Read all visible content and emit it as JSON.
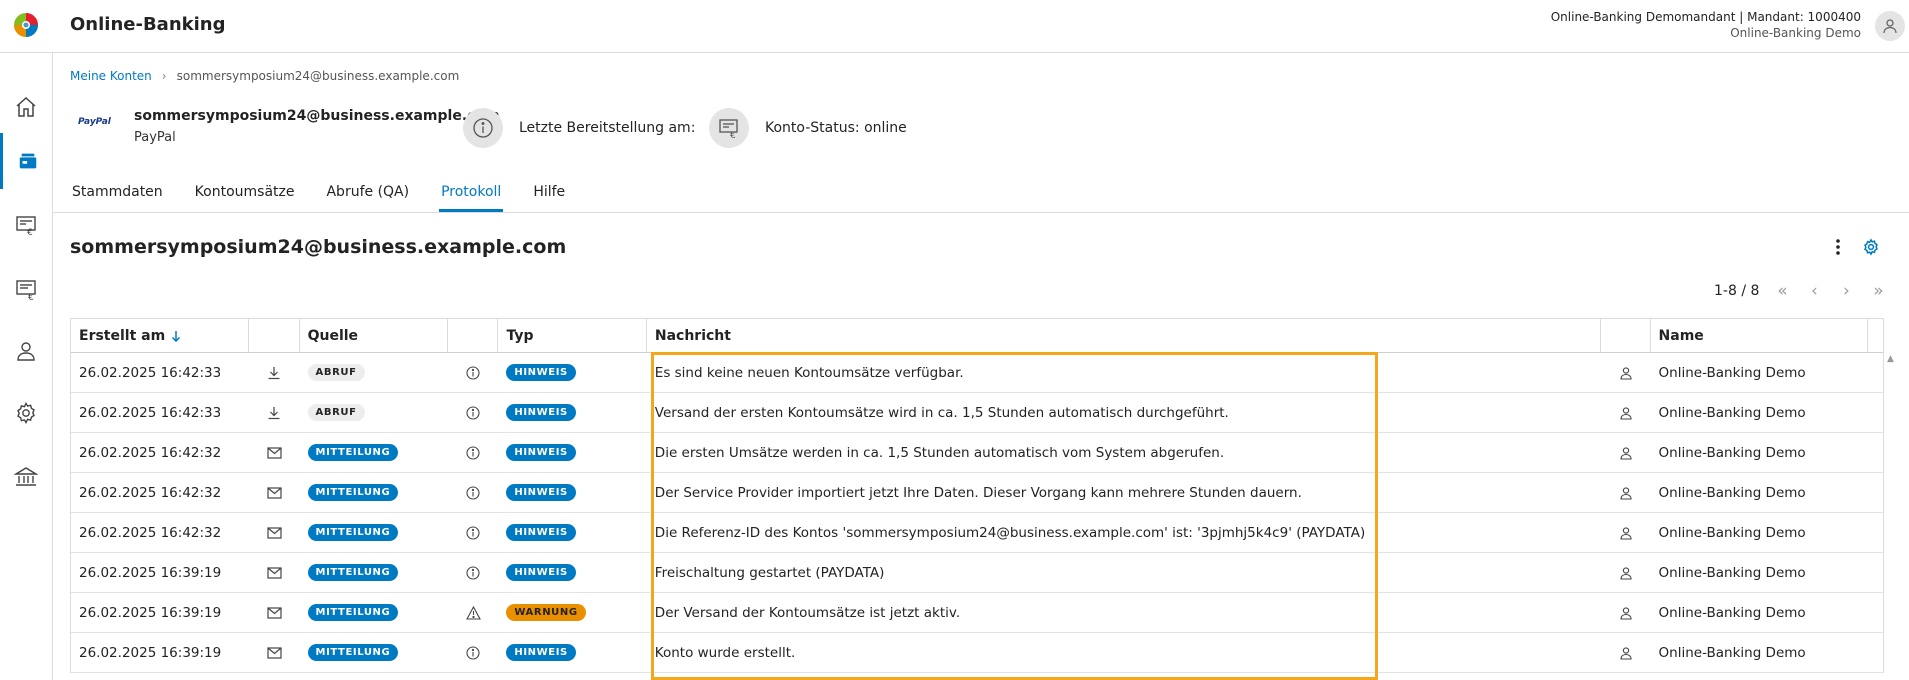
{
  "header": {
    "app_title": "Online-Banking",
    "tenant_line1": "Online-Banking Demomandant | Mandant: 1000400",
    "tenant_line2": "Online-Banking Demo"
  },
  "sidebar": {
    "items": [
      {
        "icon": "home-icon"
      },
      {
        "icon": "accounts-icon",
        "active": true
      },
      {
        "icon": "payments-icon"
      },
      {
        "icon": "statements-icon"
      },
      {
        "icon": "user-icon"
      },
      {
        "icon": "gear-icon"
      },
      {
        "icon": "bank-icon"
      }
    ]
  },
  "breadcrumb": {
    "root": "Meine Konten",
    "current": "sommersymposium24@business.example.com"
  },
  "account": {
    "logo_text": "PayPal",
    "name": "sommersymposium24@business.example.com",
    "provider": "PayPal",
    "last_provision_label": "Letzte Bereitstellung am:",
    "status_label": "Konto-Status: online"
  },
  "tabs": [
    {
      "label": "Stammdaten"
    },
    {
      "label": "Kontoumsätze"
    },
    {
      "label": "Abrufe (QA)"
    },
    {
      "label": "Protokoll",
      "active": true
    },
    {
      "label": "Hilfe"
    }
  ],
  "section": {
    "title": "sommersymposium24@business.example.com"
  },
  "pager": {
    "range": "1-8 / 8"
  },
  "table": {
    "columns": {
      "created": "Erstellt am",
      "source": "Quelle",
      "type": "Typ",
      "message": "Nachricht",
      "name": "Name"
    },
    "rows": [
      {
        "created": "26.02.2025 16:42:33",
        "source_icon": "download-icon",
        "source": "ABRUF",
        "type_icon": "info-icon",
        "type": "HINWEIS",
        "message": "Es sind keine neuen Kontoumsätze verfügbar.",
        "name": "Online-Banking Demo"
      },
      {
        "created": "26.02.2025 16:42:33",
        "source_icon": "download-icon",
        "source": "ABRUF",
        "type_icon": "info-icon",
        "type": "HINWEIS",
        "message": "Versand der ersten Kontoumsätze wird in ca. 1,5 Stunden automatisch durchgeführt.",
        "name": "Online-Banking Demo"
      },
      {
        "created": "26.02.2025 16:42:32",
        "source_icon": "mail-icon",
        "source": "MITTEILUNG",
        "type_icon": "info-icon",
        "type": "HINWEIS",
        "message": "Die ersten Umsätze werden in ca. 1,5 Stunden automatisch vom System abgerufen.",
        "name": "Online-Banking Demo"
      },
      {
        "created": "26.02.2025 16:42:32",
        "source_icon": "mail-icon",
        "source": "MITTEILUNG",
        "type_icon": "info-icon",
        "type": "HINWEIS",
        "message": "Der Service Provider importiert jetzt Ihre Daten. Dieser Vorgang kann mehrere Stunden dauern.",
        "name": "Online-Banking Demo"
      },
      {
        "created": "26.02.2025 16:42:32",
        "source_icon": "mail-icon",
        "source": "MITTEILUNG",
        "type_icon": "info-icon",
        "type": "HINWEIS",
        "message": "Die Referenz-ID des Kontos 'sommersymposium24@business.example.com' ist: '3pjmhj5k4c9' (PAYDATA)",
        "name": "Online-Banking Demo"
      },
      {
        "created": "26.02.2025 16:39:19",
        "source_icon": "mail-icon",
        "source": "MITTEILUNG",
        "type_icon": "info-icon",
        "type": "HINWEIS",
        "message": "Freischaltung gestartet (PAYDATA)",
        "name": "Online-Banking Demo"
      },
      {
        "created": "26.02.2025 16:39:19",
        "source_icon": "mail-icon",
        "source": "MITTEILUNG",
        "type_icon": "warning-icon",
        "type": "WARNUNG",
        "message": "Der Versand der Kontoumsätze ist jetzt aktiv.",
        "name": "Online-Banking Demo"
      },
      {
        "created": "26.02.2025 16:39:19",
        "source_icon": "mail-icon",
        "source": "MITTEILUNG",
        "type_icon": "info-icon",
        "type": "HINWEIS",
        "message": "Konto wurde erstellt.",
        "name": "Online-Banking Demo"
      }
    ]
  },
  "colors": {
    "accent": "#007ac3",
    "warning": "#ea8f00",
    "highlight": "#f2a81a"
  }
}
